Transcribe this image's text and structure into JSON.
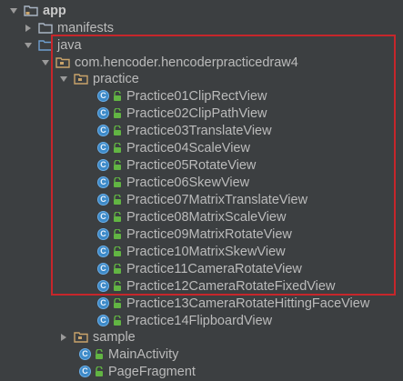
{
  "tree": {
    "root": {
      "label": "app"
    },
    "manifests": {
      "label": "manifests"
    },
    "java": {
      "label": "java"
    },
    "package": {
      "label": "com.hencoder.hencoderpracticedraw4"
    },
    "practice": {
      "label": "practice"
    },
    "practice_items": [
      "Practice01ClipRectView",
      "Practice02ClipPathView",
      "Practice03TranslateView",
      "Practice04ScaleView",
      "Practice05RotateView",
      "Practice06SkewView",
      "Practice07MatrixTranslateView",
      "Practice08MatrixScaleView",
      "Practice09MatrixRotateView",
      "Practice10MatrixSkewView",
      "Practice11CameraRotateView",
      "Practice12CameraRotateFixedView",
      "Practice13CameraRotateHittingFaceView",
      "Practice14FlipboardView"
    ],
    "sample": {
      "label": "sample"
    },
    "classes": [
      "MainActivity",
      "PageFragment"
    ]
  },
  "class_icon_letter": "C",
  "icons": {
    "expanded": "chevron-down-icon",
    "collapsed": "chevron-right-icon",
    "folder": "folder-icon",
    "package": "package-icon",
    "class": "class-icon",
    "access": "unlock-icon"
  },
  "colors": {
    "background": "#3c3f41",
    "text": "#bbbbbb",
    "folder": "#a9b5c4",
    "package_folder": "#c9a36a",
    "class_icon": "#3d8ac8",
    "lock": "#62b543",
    "highlight_border": "#c7262b"
  }
}
